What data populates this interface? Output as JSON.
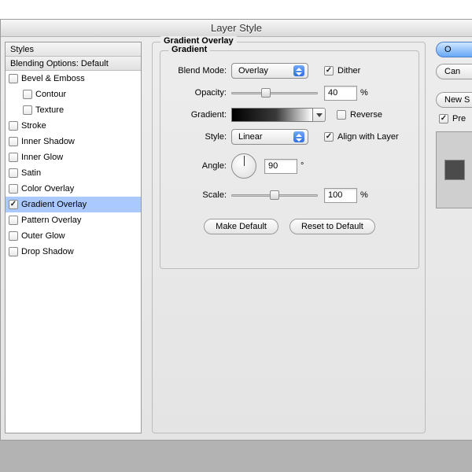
{
  "title": "Layer Style",
  "styles": {
    "header": "Styles",
    "subheader": "Blending Options: Default",
    "items": [
      {
        "label": "Bevel & Emboss",
        "checked": false,
        "sub": false
      },
      {
        "label": "Contour",
        "checked": false,
        "sub": true
      },
      {
        "label": "Texture",
        "checked": false,
        "sub": true
      },
      {
        "label": "Stroke",
        "checked": false,
        "sub": false
      },
      {
        "label": "Inner Shadow",
        "checked": false,
        "sub": false
      },
      {
        "label": "Inner Glow",
        "checked": false,
        "sub": false
      },
      {
        "label": "Satin",
        "checked": false,
        "sub": false
      },
      {
        "label": "Color Overlay",
        "checked": false,
        "sub": false
      },
      {
        "label": "Gradient Overlay",
        "checked": true,
        "sub": false,
        "selected": true
      },
      {
        "label": "Pattern Overlay",
        "checked": false,
        "sub": false
      },
      {
        "label": "Outer Glow",
        "checked": false,
        "sub": false
      },
      {
        "label": "Drop Shadow",
        "checked": false,
        "sub": false
      }
    ]
  },
  "group": {
    "title": "Gradient Overlay",
    "inner_title": "Gradient",
    "labels": {
      "blend_mode": "Blend Mode:",
      "opacity": "Opacity:",
      "gradient": "Gradient:",
      "style": "Style:",
      "angle": "Angle:",
      "scale": "Scale:"
    },
    "blend_mode": "Overlay",
    "dither_label": "Dither",
    "dither": true,
    "opacity": "40",
    "percent": "%",
    "reverse_label": "Reverse",
    "reverse": false,
    "style": "Linear",
    "align_label": "Align with Layer",
    "align": true,
    "angle": "90",
    "degree": "°",
    "scale": "100",
    "make_default": "Make Default",
    "reset_default": "Reset to Default"
  },
  "right": {
    "ok": "O",
    "cancel": "Can",
    "new_style": "New S",
    "preview_label": "Pre",
    "preview_checked": true
  }
}
